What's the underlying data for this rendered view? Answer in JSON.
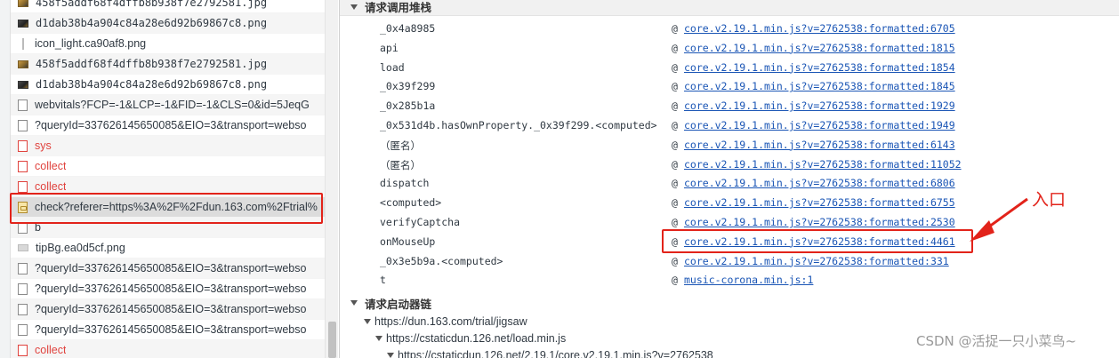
{
  "request_list": {
    "rows": [
      {
        "name": "458f5addf68f4dffb8b938f7e2792581.jpg",
        "icon": "image-thumbnail-icon",
        "status": "ok"
      },
      {
        "name": "d1dab38b4a904c84a28e6d92b69867c8.png",
        "icon": "image-thumbnail-icon",
        "status": "ok"
      },
      {
        "name": "icon_light.ca90af8.png",
        "icon": "thin-image-icon",
        "status": "ok"
      },
      {
        "name": "458f5addf68f4dffb8b938f7e2792581.jpg",
        "icon": "image-thumbnail-icon",
        "status": "ok"
      },
      {
        "name": "d1dab38b4a904c84a28e6d92b69867c8.png",
        "icon": "image-thumbnail-icon",
        "status": "ok"
      },
      {
        "name": "webvitals?FCP=-1&LCP=-1&FID=-1&CLS=0&id=5JeqG",
        "icon": "document-icon",
        "status": "ok"
      },
      {
        "name": "?queryId=337626145650085&EIO=3&transport=webso",
        "icon": "document-icon",
        "status": "ok"
      },
      {
        "name": "sys",
        "icon": "document-icon",
        "status": "error"
      },
      {
        "name": "collect",
        "icon": "document-icon",
        "status": "error"
      },
      {
        "name": "collect",
        "icon": "document-icon",
        "status": "error"
      },
      {
        "name": "check?referer=https%3A%2F%2Fdun.163.com%2Ftrial%",
        "icon": "xhr-script-icon",
        "status": "ok"
      },
      {
        "name": "b",
        "icon": "document-icon",
        "status": "ok"
      },
      {
        "name": "tipBg.ea0d5cf.png",
        "icon": "png-image-icon",
        "status": "ok"
      },
      {
        "name": "?queryId=337626145650085&EIO=3&transport=webso",
        "icon": "document-icon",
        "status": "ok"
      },
      {
        "name": "?queryId=337626145650085&EIO=3&transport=webso",
        "icon": "document-icon",
        "status": "ok"
      },
      {
        "name": "?queryId=337626145650085&EIO=3&transport=webso",
        "icon": "document-icon",
        "status": "ok"
      },
      {
        "name": "?queryId=337626145650085&EIO=3&transport=webso",
        "icon": "document-icon",
        "status": "ok"
      },
      {
        "name": "collect",
        "icon": "document-icon",
        "status": "error"
      }
    ]
  },
  "stack": {
    "header": "请求调用堆栈",
    "frames": [
      {
        "fn": "_0x4a8985",
        "at": "@",
        "location": "core.v2.19.1.min.js?v=2762538:formatted:6705"
      },
      {
        "fn": "api",
        "at": "@",
        "location": "core.v2.19.1.min.js?v=2762538:formatted:1815"
      },
      {
        "fn": "load",
        "at": "@",
        "location": "core.v2.19.1.min.js?v=2762538:formatted:1854"
      },
      {
        "fn": "_0x39f299",
        "at": "@",
        "location": "core.v2.19.1.min.js?v=2762538:formatted:1845"
      },
      {
        "fn": "_0x285b1a",
        "at": "@",
        "location": "core.v2.19.1.min.js?v=2762538:formatted:1929"
      },
      {
        "fn": "_0x531d4b.hasOwnProperty._0x39f299.<computed>",
        "at": "@",
        "location": "core.v2.19.1.min.js?v=2762538:formatted:1949"
      },
      {
        "fn": "（匿名）",
        "at": "@",
        "location": "core.v2.19.1.min.js?v=2762538:formatted:6143"
      },
      {
        "fn": "（匿名）",
        "at": "@",
        "location": "core.v2.19.1.min.js?v=2762538:formatted:11052"
      },
      {
        "fn": "dispatch",
        "at": "@",
        "location": "core.v2.19.1.min.js?v=2762538:formatted:6806"
      },
      {
        "fn": "<computed>",
        "at": "@",
        "location": "core.v2.19.1.min.js?v=2762538:formatted:6755"
      },
      {
        "fn": "verifyCaptcha",
        "at": "@",
        "location": "core.v2.19.1.min.js?v=2762538:formatted:2530"
      },
      {
        "fn": "onMouseUp",
        "at": "@",
        "location": "core.v2.19.1.min.js?v=2762538:formatted:4461"
      },
      {
        "fn": "_0x3e5b9a.<computed>",
        "at": "@",
        "location": "core.v2.19.1.min.js?v=2762538:formatted:331"
      },
      {
        "fn": "t",
        "at": "@",
        "location": "music-corona.min.js:1"
      }
    ]
  },
  "initiator_chain": {
    "header": "请求启动器链",
    "items": [
      {
        "url": "https://dun.163.com/trial/jigsaw",
        "depth": 0
      },
      {
        "url": "https://cstaticdun.126.net/load.min.js",
        "depth": 1
      },
      {
        "url": "https://cstaticdun.126.net/2.19.1/core.v2.19.1.min.js?v=2762538",
        "depth": 2
      }
    ]
  },
  "annotation": {
    "label": "入口",
    "color": "#e2231a"
  },
  "watermark": "CSDN @活捉一只小菜鸟~",
  "colors": {
    "link": "#1a55b5",
    "error_text": "#e0433e",
    "highlight_border": "#e2231a"
  }
}
